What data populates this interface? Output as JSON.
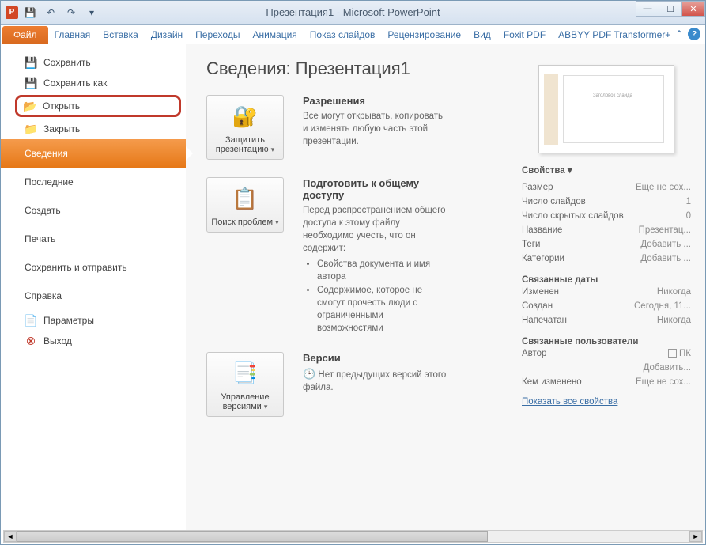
{
  "title": "Презентация1 - Microsoft PowerPoint",
  "qat": {
    "save": "💾",
    "undo": "↶",
    "redo": "↷"
  },
  "tabs": {
    "file": "Файл",
    "items": [
      "Главная",
      "Вставка",
      "Дизайн",
      "Переходы",
      "Анимация",
      "Показ слайдов",
      "Рецензирование",
      "Вид",
      "Foxit PDF",
      "ABBYY PDF Transformer+"
    ]
  },
  "sidebar": {
    "save": "Сохранить",
    "saveas": "Сохранить как",
    "open": "Открыть",
    "close": "Закрыть",
    "info": "Сведения",
    "recent": "Последние",
    "new": "Создать",
    "print": "Печать",
    "share": "Сохранить и отправить",
    "help": "Справка",
    "options": "Параметры",
    "exit": "Выход"
  },
  "main": {
    "title": "Сведения: Презентация1",
    "protect": {
      "btn": "Защитить презентацию",
      "h": "Разрешения",
      "p": "Все могут открывать, копировать и изменять любую часть этой презентации."
    },
    "check": {
      "btn": "Поиск проблем",
      "h": "Подготовить к общему доступу",
      "p": "Перед распространением общего доступа к этому файлу необходимо учесть, что он содержит:",
      "li1": "Свойства документа и имя автора",
      "li2": "Содержимое, которое не смогут прочесть люди с ограниченными возможностями"
    },
    "versions": {
      "btn": "Управление версиями",
      "h": "Версии",
      "p": "Нет предыдущих версий этого файла."
    }
  },
  "props": {
    "header": "Свойства",
    "rows": [
      {
        "k": "Размер",
        "v": "Еще не сох..."
      },
      {
        "k": "Число слайдов",
        "v": "1"
      },
      {
        "k": "Число скрытых слайдов",
        "v": "0"
      },
      {
        "k": "Название",
        "v": "Презентац..."
      },
      {
        "k": "Теги",
        "v": "Добавить ..."
      },
      {
        "k": "Категории",
        "v": "Добавить ..."
      }
    ],
    "dates_h": "Связанные даты",
    "dates": [
      {
        "k": "Изменен",
        "v": "Никогда"
      },
      {
        "k": "Создан",
        "v": "Сегодня, 11..."
      },
      {
        "k": "Напечатан",
        "v": "Никогда"
      }
    ],
    "users_h": "Связанные пользователи",
    "author_k": "Автор",
    "author_v": "ПК",
    "author_add": "Добавить...",
    "changed_k": "Кем изменено",
    "changed_v": "Еще не сох...",
    "showall": "Показать все свойства"
  },
  "thumb_title": "Заголовок слайда"
}
